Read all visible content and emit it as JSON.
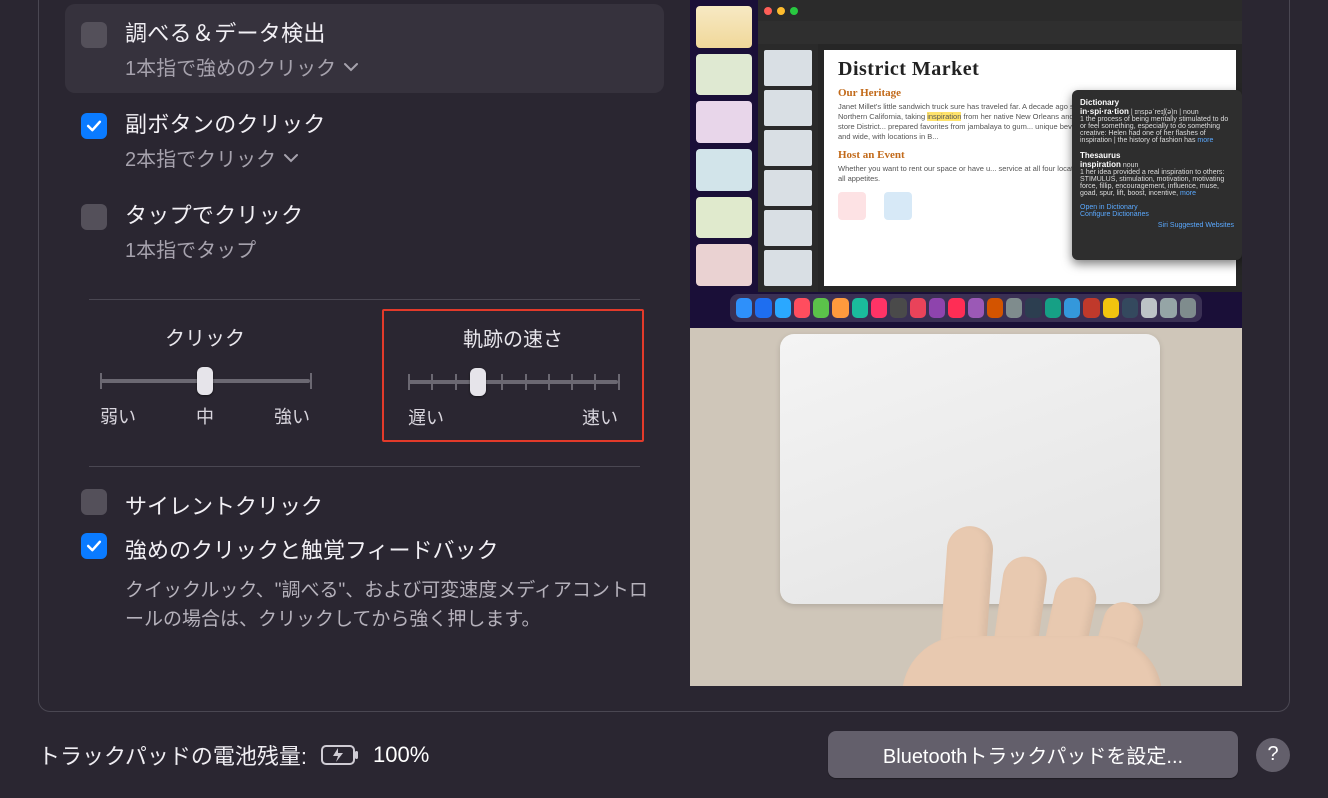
{
  "options": {
    "look_up": {
      "title": "調べる＆データ検出",
      "subtitle": "1本指で強めのクリック",
      "checked": false,
      "has_menu": true
    },
    "secondary_click": {
      "title": "副ボタンのクリック",
      "subtitle": "2本指でクリック",
      "checked": true,
      "has_menu": true
    },
    "tap_to_click": {
      "title": "タップでクリック",
      "subtitle": "1本指でタップ",
      "checked": false,
      "has_menu": false
    }
  },
  "sliders": {
    "click": {
      "title": "クリック",
      "min_label": "弱い",
      "mid_label": "中",
      "max_label": "強い",
      "ticks": 3,
      "value_index": 1
    },
    "tracking": {
      "title": "軌跡の速さ",
      "min_label": "遅い",
      "max_label": "速い",
      "ticks": 10,
      "value_index": 3,
      "highlighted": true
    }
  },
  "lower": {
    "silent_click": {
      "title": "サイレントクリック",
      "checked": false
    },
    "force_click": {
      "title": "強めのクリックと触覚フィードバック",
      "checked": true,
      "description": "クイックルック、\"調べる\"、および可変速度メディアコントロールの場合は、クリックしてから強く押します。"
    }
  },
  "preview": {
    "doc_title": "District Market",
    "h_heritage": "Our Heritage",
    "heritage_p1": "Janet Millet's little sandwich truck sure has traveled far. A decade ago she opened a mobile sandwich shop in Northern California, taking ",
    "heritage_hl": "inspiration",
    "heritage_p2": " from her native New Orleans and the broad... success led her to open the store District... prepared favorites from jambalaya to gum... unique beverages, and pantry necessiti... Markets far and wide, with locations in B...",
    "h_host": "Host an Event",
    "host_p": "Whether you want to rent our space or have u... service at all four locations (Brooklyn, London,... can accommodate all appetites.",
    "dict_title": "Dictionary",
    "dict_word": "in·spi·ra·tion",
    "dict_pos": " | ɪnspəˈreɪʃ(ə)n | noun",
    "dict_def": "1 the process of being mentally stimulated to do or feel something, especially to do something creative: Helen had one of her flashes of inspiration | the history of fashion has ",
    "dict_more1": "more",
    "thes_title": "Thesaurus",
    "thes_word": "inspiration",
    "thes_pos": " noun",
    "thes_def": "1 her idea provided a real inspiration to others: STIMULUS, stimulation, motivation, motivating force, fillip, encouragement, influence, muse, goad, spur, lift, boost, incentive, ",
    "dict_more2": "more",
    "dict_link1": "Open in Dictionary",
    "dict_link2": "Configure Dictionaries",
    "dict_link3": "Siri Suggested Websites"
  },
  "footer": {
    "battery_label": "トラックパッドの電池残量:",
    "battery_pct": "100%",
    "bt_button": "Bluetoothトラックパッドを設定...",
    "help": "?"
  },
  "dock_colors": [
    "#2e90fa",
    "#1e6ef0",
    "#2aa8ff",
    "#ff4d5e",
    "#5bc24a",
    "#ff9a3d",
    "#1abc9c",
    "#ff3366",
    "#4a4a4a",
    "#e9435a",
    "#8e44ad",
    "#ff2d55",
    "#9b59b6",
    "#d35400",
    "#7f8c8d",
    "#2c3e50",
    "#16a085",
    "#3498db",
    "#c0392b",
    "#f1c40f",
    "#34495e",
    "#bdc3c7",
    "#95a5a6",
    "#7f8c8d"
  ]
}
